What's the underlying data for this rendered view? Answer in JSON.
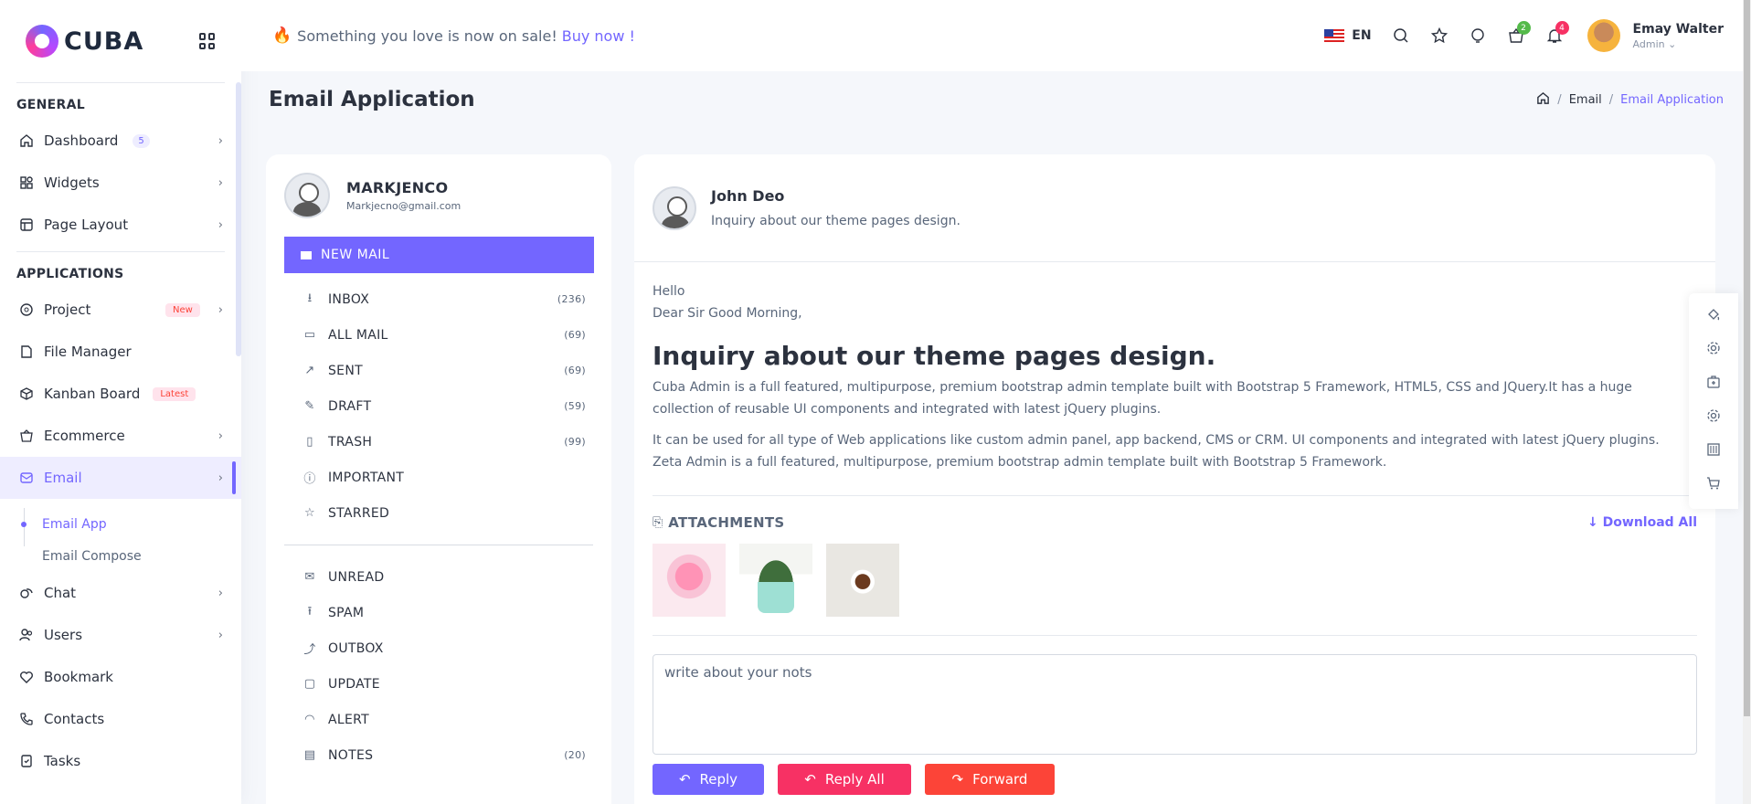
{
  "brand": {
    "name": "CUBA"
  },
  "header": {
    "promo_text": "Something you love is now on sale!",
    "promo_link": "Buy now !",
    "language": "EN",
    "cart_count": "2",
    "notification_count": "4",
    "user_name": "Emay Walter",
    "user_role": "Admin",
    "colors": {
      "cart_badge": "#54ba4a",
      "notif_badge": "#f73164"
    }
  },
  "sidebar": {
    "general_title": "GENERAL",
    "general_items": [
      {
        "label": "Dashboard",
        "badge": "5"
      },
      {
        "label": "Widgets"
      },
      {
        "label": "Page Layout"
      }
    ],
    "apps_title": "APPLICATIONS",
    "project": {
      "label": "Project",
      "badge": "New"
    },
    "file_manager": "File Manager",
    "kanban": {
      "label": "Kanban Board",
      "badge": "Latest"
    },
    "ecommerce": "Ecommerce",
    "email": "Email",
    "email_sub": [
      "Email App",
      "Email Compose"
    ],
    "chat": "Chat",
    "users": "Users",
    "bookmark": "Bookmark",
    "contacts": "Contacts",
    "tasks": "Tasks"
  },
  "page": {
    "title": "Email Application",
    "breadcrumb": [
      "Email",
      "Email Application"
    ]
  },
  "mailbox": {
    "user_name": "MARKJENCO",
    "user_email": "Markjecno@gmail.com",
    "new_mail_label": "NEW MAIL",
    "folders_top": [
      {
        "label": "INBOX",
        "count": "(236)",
        "icon": "download-icon"
      },
      {
        "label": "ALL MAIL",
        "count": "(69)",
        "icon": "folder-icon"
      },
      {
        "label": "SENT",
        "count": "(69)",
        "icon": "external-link-icon"
      },
      {
        "label": "DRAFT",
        "count": "(59)",
        "icon": "edit-icon"
      },
      {
        "label": "TRASH",
        "count": "(99)",
        "icon": "trash-icon"
      },
      {
        "label": "IMPORTANT",
        "count": "",
        "icon": "info-icon"
      },
      {
        "label": "STARRED",
        "count": "",
        "icon": "star-icon"
      }
    ],
    "folders_bottom": [
      {
        "label": "UNREAD",
        "count": "",
        "icon": "envelope-icon"
      },
      {
        "label": "SPAM",
        "count": "",
        "icon": "upload-icon"
      },
      {
        "label": "OUTBOX",
        "count": "",
        "icon": "share-icon"
      },
      {
        "label": "UPDATE",
        "count": "",
        "icon": "file-icon"
      },
      {
        "label": "ALERT",
        "count": "",
        "icon": "bell-icon"
      },
      {
        "label": "NOTES",
        "count": "(20)",
        "icon": "calendar-icon"
      }
    ]
  },
  "message": {
    "sender_name": "John Deo",
    "sender_subject": "Inquiry about our theme pages design.",
    "greeting_1": "Hello",
    "greeting_2": "Dear Sir Good Morning,",
    "title": "Inquiry about our theme pages design.",
    "paragraph_1": "Cuba Admin is a full featured, multipurpose, premium bootstrap admin template built with Bootstrap 5 Framework, HTML5, CSS and JQuery.It has a huge collection of reusable UI components and integrated with latest jQuery plugins.",
    "paragraph_2": "It can be used for all type of Web applications like custom admin panel, app backend, CMS or CRM. UI components and integrated with latest jQuery plugins. Zeta Admin is a full featured, multipurpose, premium bootstrap admin template built with Bootstrap 5 Framework.",
    "attachments_title": "ATTACHMENTS",
    "download_all": "Download All",
    "note_placeholder": "write about your nots",
    "reply_label": "Reply",
    "reply_all_label": "Reply All",
    "forward_label": "Forward"
  },
  "theme": {
    "primary": "#7366ff",
    "secondary": "#f73164",
    "danger": "#fc4438"
  }
}
